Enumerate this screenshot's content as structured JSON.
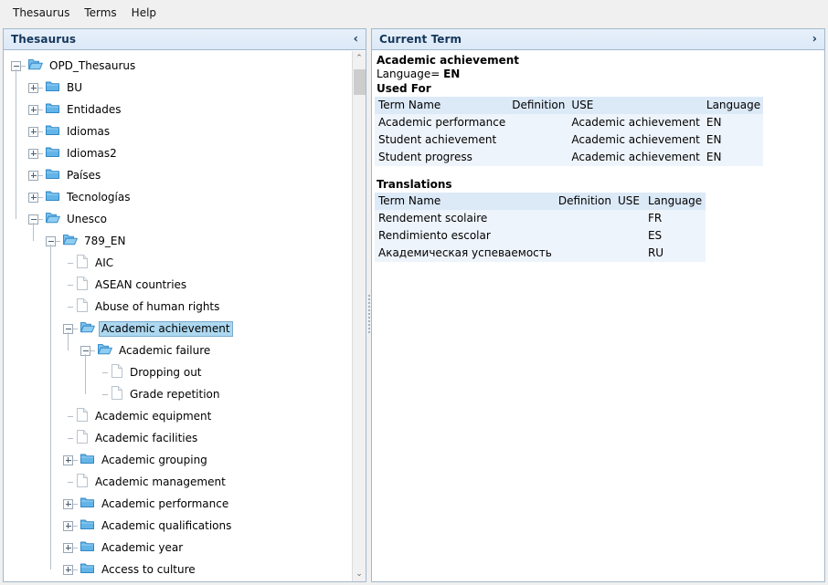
{
  "menubar": {
    "items": [
      {
        "label": "Thesaurus",
        "name": "menu-thesaurus"
      },
      {
        "label": "Terms",
        "name": "menu-terms"
      },
      {
        "label": "Help",
        "name": "menu-help"
      }
    ]
  },
  "left_panel": {
    "title": "Thesaurus",
    "collapse_icon": "chevron-left-icon",
    "collapse_glyph": "‹",
    "scrollbar": {
      "up_glyph": "⌃",
      "down_glyph": "⌄"
    }
  },
  "tree": {
    "nodes": [
      {
        "label": "OPD_Thesaurus",
        "depth": 0,
        "icon": "folder-open-icon",
        "state": "expanded",
        "selected": false
      },
      {
        "label": "BU",
        "depth": 1,
        "icon": "folder-closed-icon",
        "state": "collapsed",
        "selected": false
      },
      {
        "label": "Entidades",
        "depth": 1,
        "icon": "folder-closed-icon",
        "state": "collapsed",
        "selected": false
      },
      {
        "label": "Idiomas",
        "depth": 1,
        "icon": "folder-closed-icon",
        "state": "collapsed",
        "selected": false
      },
      {
        "label": "Idiomas2",
        "depth": 1,
        "icon": "folder-closed-icon",
        "state": "collapsed",
        "selected": false
      },
      {
        "label": "Países",
        "depth": 1,
        "icon": "folder-closed-icon",
        "state": "collapsed",
        "selected": false
      },
      {
        "label": "Tecnologías",
        "depth": 1,
        "icon": "folder-closed-icon",
        "state": "collapsed",
        "selected": false
      },
      {
        "label": "Unesco",
        "depth": 1,
        "icon": "folder-open-icon",
        "state": "expanded",
        "selected": false
      },
      {
        "label": "789_EN",
        "depth": 2,
        "icon": "folder-open-icon",
        "state": "expanded",
        "selected": false
      },
      {
        "label": "AIC",
        "depth": 3,
        "icon": "document-icon",
        "state": "leaf",
        "selected": false
      },
      {
        "label": "ASEAN countries",
        "depth": 3,
        "icon": "document-icon",
        "state": "leaf",
        "selected": false
      },
      {
        "label": "Abuse of human rights",
        "depth": 3,
        "icon": "document-icon",
        "state": "leaf",
        "selected": false
      },
      {
        "label": "Academic achievement",
        "depth": 3,
        "icon": "folder-open-icon",
        "state": "expanded",
        "selected": true
      },
      {
        "label": "Academic failure",
        "depth": 4,
        "icon": "folder-open-icon",
        "state": "expanded",
        "selected": false
      },
      {
        "label": "Dropping out",
        "depth": 5,
        "icon": "document-icon",
        "state": "leaf",
        "selected": false
      },
      {
        "label": "Grade repetition",
        "depth": 5,
        "icon": "document-icon",
        "state": "leaf",
        "selected": false
      },
      {
        "label": "Academic equipment",
        "depth": 3,
        "icon": "document-icon",
        "state": "leaf",
        "selected": false
      },
      {
        "label": "Academic facilities",
        "depth": 3,
        "icon": "document-icon",
        "state": "leaf",
        "selected": false
      },
      {
        "label": "Academic grouping",
        "depth": 3,
        "icon": "folder-closed-icon",
        "state": "collapsed",
        "selected": false
      },
      {
        "label": "Academic management",
        "depth": 3,
        "icon": "document-icon",
        "state": "leaf",
        "selected": false
      },
      {
        "label": "Academic performance",
        "depth": 3,
        "icon": "folder-closed-icon",
        "state": "collapsed",
        "selected": false
      },
      {
        "label": "Academic qualifications",
        "depth": 3,
        "icon": "folder-closed-icon",
        "state": "collapsed",
        "selected": false
      },
      {
        "label": "Academic year",
        "depth": 3,
        "icon": "folder-closed-icon",
        "state": "collapsed",
        "selected": false
      },
      {
        "label": "Access to culture",
        "depth": 3,
        "icon": "folder-closed-icon",
        "state": "collapsed",
        "selected": false
      }
    ]
  },
  "right_panel": {
    "title": "Current Term",
    "expand_icon": "chevron-right-icon",
    "expand_glyph": "›",
    "term_name": "Academic achievement",
    "language_label": "Language=",
    "language_value": "EN",
    "used_for": {
      "heading": "Used For",
      "columns": [
        "Term Name",
        "Definition",
        "USE",
        "Language"
      ],
      "rows": [
        [
          "Academic performance",
          "",
          "Academic achievement",
          "EN"
        ],
        [
          "Student achievement",
          "",
          "Academic achievement",
          "EN"
        ],
        [
          "Student progress",
          "",
          "Academic achievement",
          "EN"
        ]
      ]
    },
    "translations": {
      "heading": "Translations",
      "columns": [
        "Term Name",
        "Definition",
        "USE",
        "Language"
      ],
      "rows": [
        [
          "Rendement scolaire",
          "",
          "",
          "FR"
        ],
        [
          "Rendimiento escolar",
          "",
          "",
          "ES"
        ],
        [
          "Академическая успеваемость",
          "",
          "",
          "RU"
        ]
      ]
    }
  },
  "colors": {
    "panel_header": "#dce9f7",
    "panel_border": "#a3b8cc",
    "selection": "#add8f0",
    "grid_header": "#dce9f7",
    "grid_row": "#eef4fb",
    "folder": "#5aa9e0",
    "window_bg": "#f0f0f0"
  }
}
